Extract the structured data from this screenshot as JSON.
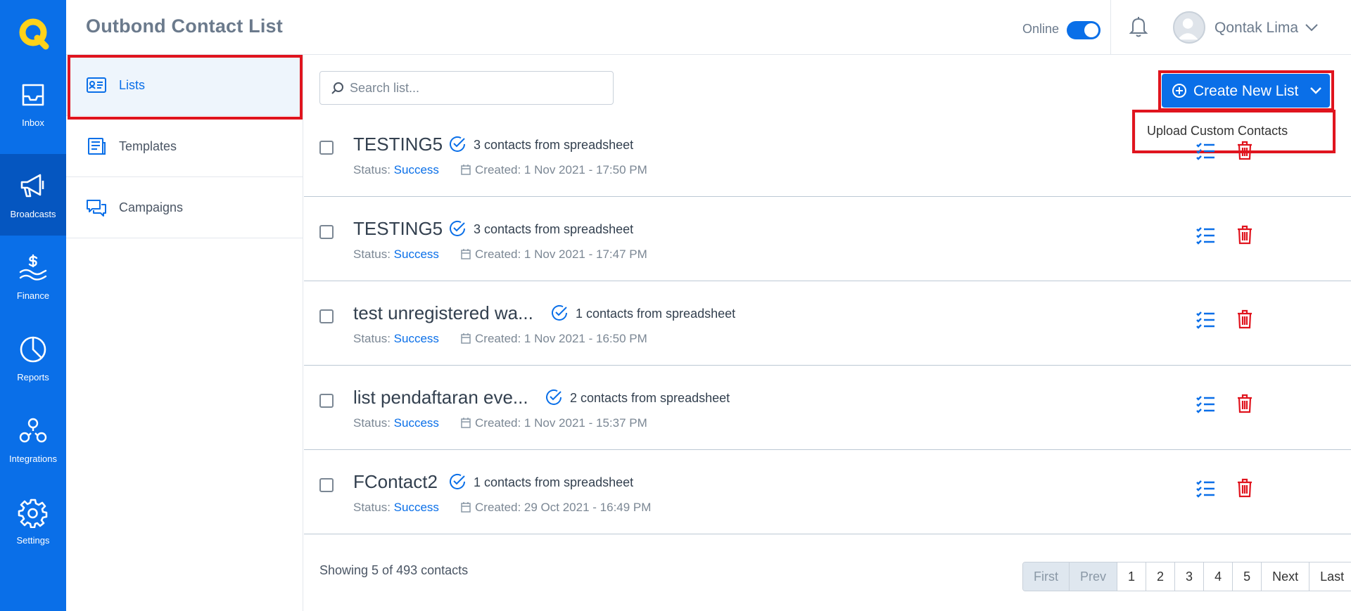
{
  "app": {
    "brand_color": "#0a6fe8",
    "highlight_color": "#e0141e"
  },
  "rail": {
    "items": [
      {
        "label": "Inbox",
        "icon": "inbox-icon"
      },
      {
        "label": "Broadcasts",
        "icon": "megaphone-icon",
        "active": true
      },
      {
        "label": "Finance",
        "icon": "dollar-hand-icon"
      },
      {
        "label": "Reports",
        "icon": "pie-chart-icon"
      },
      {
        "label": "Integrations",
        "icon": "integrations-icon"
      },
      {
        "label": "Settings",
        "icon": "gear-icon"
      }
    ]
  },
  "header": {
    "title": "Outbond Contact List",
    "online_label": "Online",
    "online": true,
    "user_name": "Qontak Lima"
  },
  "subnav": {
    "items": [
      {
        "label": "Lists",
        "icon": "contact-card-icon",
        "active": true
      },
      {
        "label": "Templates",
        "icon": "templates-icon"
      },
      {
        "label": "Campaigns",
        "icon": "chat-bubbles-icon"
      }
    ]
  },
  "search": {
    "placeholder": "Search list...",
    "value": ""
  },
  "create_button": {
    "label": "Create New List"
  },
  "dropdown": {
    "items": [
      "Upload Custom Contacts"
    ]
  },
  "lists": [
    {
      "name": "TESTING5",
      "count": "3 contacts from spreadsheet",
      "status_label": "Status:",
      "status": "Success",
      "created": "Created: 1 Nov 2021 - 17:50 PM"
    },
    {
      "name": "TESTING5",
      "count": "3 contacts from spreadsheet",
      "status_label": "Status:",
      "status": "Success",
      "created": "Created: 1 Nov 2021 - 17:47 PM"
    },
    {
      "name": "test unregistered wa...",
      "count": "1 contacts from spreadsheet",
      "status_label": "Status:",
      "status": "Success",
      "created": "Created: 1 Nov 2021 - 16:50 PM"
    },
    {
      "name": "list pendaftaran eve...",
      "count": "2 contacts from spreadsheet",
      "status_label": "Status:",
      "status": "Success",
      "created": "Created: 1 Nov 2021 - 15:37 PM"
    },
    {
      "name": "FContact2",
      "count": "1 contacts from spreadsheet",
      "status_label": "Status:",
      "status": "Success",
      "created": "Created: 29 Oct 2021 - 16:49 PM"
    }
  ],
  "footer": {
    "showing": "Showing 5 of 493 contacts",
    "pager": [
      "First",
      "Prev",
      "1",
      "2",
      "3",
      "4",
      "5",
      "Next",
      "Last"
    ],
    "disabled": [
      "First",
      "Prev"
    ]
  }
}
